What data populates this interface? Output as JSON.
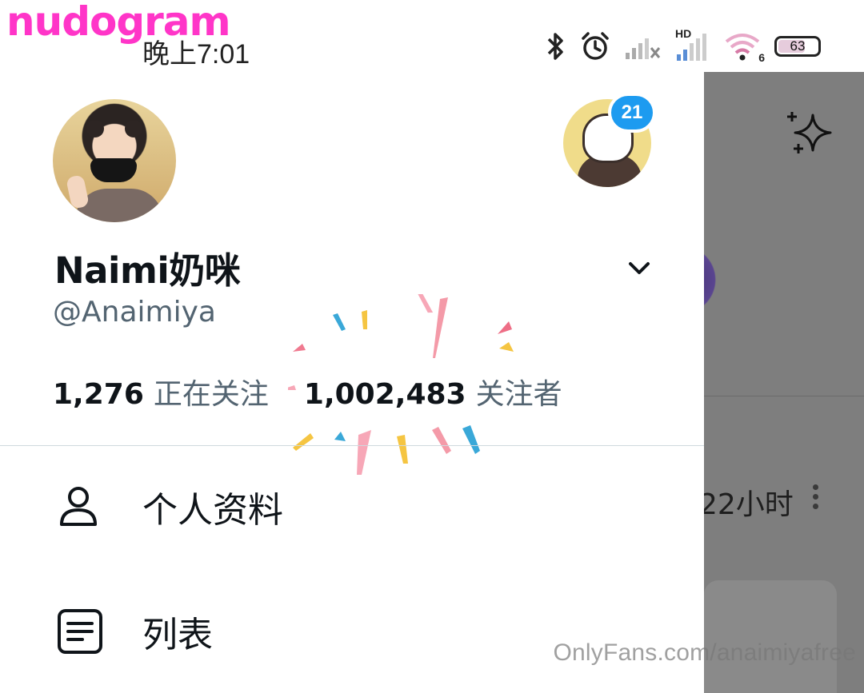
{
  "watermark": {
    "logo_text": "nudogram",
    "footer_text": "OnlyFans.com/anaimiyafree"
  },
  "status_bar": {
    "time": "晚上7:01",
    "icons": [
      "bluetooth-icon",
      "alarm-icon",
      "signal-icon",
      "hd-signal-icon",
      "wifi-icon"
    ],
    "wifi_label": "6",
    "hd_label": "HD",
    "battery_level": "63"
  },
  "profile": {
    "display_name": "Naimi奶咪",
    "handle": "@Anaimiya",
    "following_count": "1,276",
    "following_label": "正在关注",
    "followers_count": "1,002,483",
    "followers_label": "关注者"
  },
  "account_switcher": {
    "badge_count": "21"
  },
  "menu": {
    "items": [
      {
        "label": "个人资料",
        "icon": "person-icon"
      },
      {
        "label": "列表",
        "icon": "list-icon"
      }
    ]
  },
  "background_timeline": {
    "timestamp": "22小时"
  },
  "colors": {
    "accent": "#1d9bf0",
    "text_primary": "#0f1419",
    "text_secondary": "#536471",
    "scrim": "#7e7e7e",
    "watermark_pink": "#ff35c8"
  }
}
